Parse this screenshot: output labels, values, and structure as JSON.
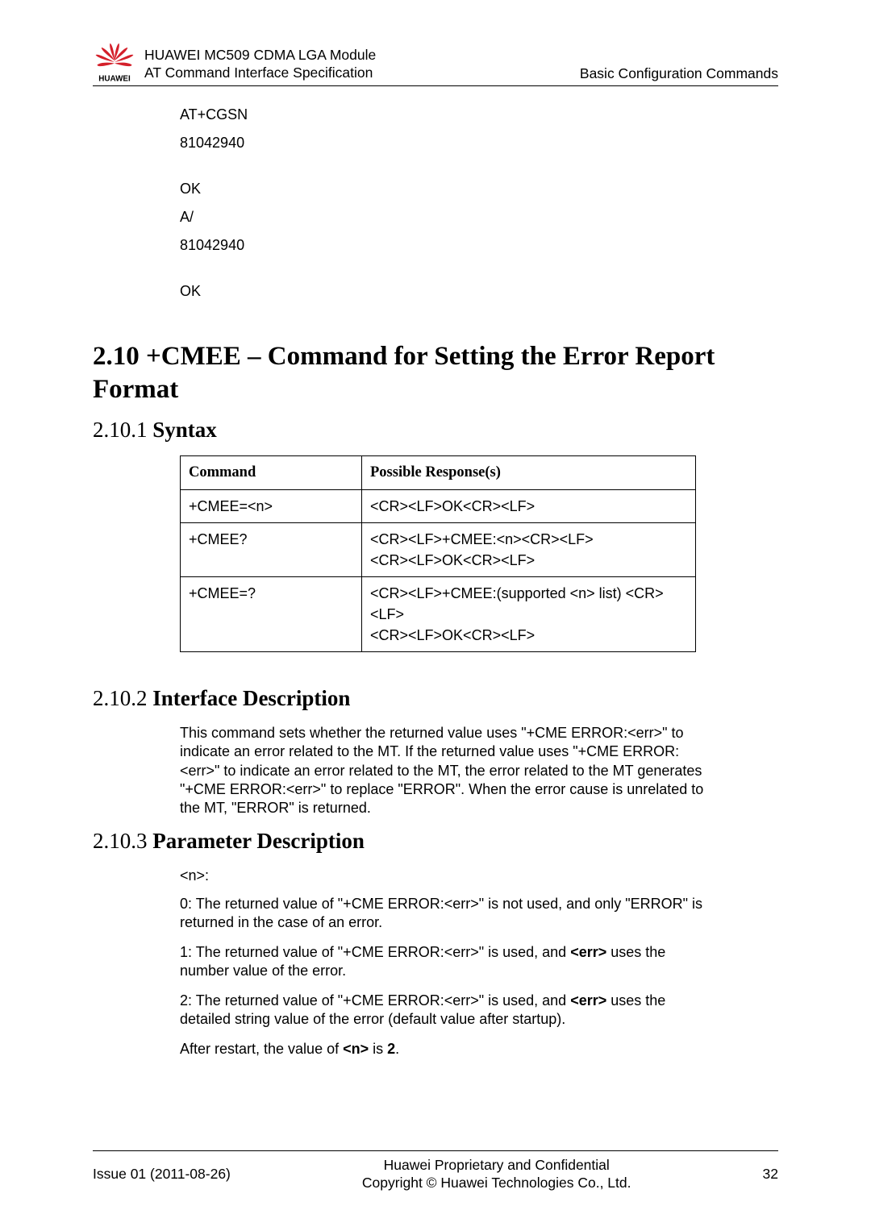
{
  "header": {
    "line1": "HUAWEI MC509 CDMA LGA Module",
    "line2": "AT Command Interface Specification",
    "right": "Basic Configuration Commands",
    "logo_text": "HUAWEI"
  },
  "code": {
    "l1": "AT+CGSN",
    "l2": "81042940",
    "l3": "OK",
    "l4": "A/",
    "l5": "81042940",
    "l6": "OK"
  },
  "section": {
    "h2": "2.10 +CMEE – Command for Setting the Error Report Format",
    "s1_num": "2.10.1 ",
    "s1_title": "Syntax",
    "s2_num": "2.10.2 ",
    "s2_title": "Interface Description",
    "s3_num": "2.10.3 ",
    "s3_title": "Parameter Description"
  },
  "table": {
    "h1": "Command",
    "h2": "Possible Response(s)",
    "r1c1": "+CMEE=<n>",
    "r1c2": "<CR><LF>OK<CR><LF>",
    "r2c1": "+CMEE?",
    "r2c2a": "<CR><LF>+CMEE:<n><CR><LF>",
    "r2c2b": "<CR><LF>OK<CR><LF>",
    "r3c1": "+CMEE=?",
    "r3c2a": "<CR><LF>+CMEE:(supported <n> list) <CR><LF>",
    "r3c2b": "<CR><LF>OK<CR><LF>"
  },
  "desc": {
    "interface": "This command sets whether the returned value uses \"+CME ERROR:<err>\" to indicate an error related to the MT. If the returned value uses \"+CME ERROR:<err>\" to indicate an error related to the MT, the error related to the MT generates \"+CME ERROR:<err>\" to replace \"ERROR\". When the error cause is unrelated to the MT, \"ERROR\" is returned.",
    "param_n": "<n>:",
    "param_0": "0: The returned value of \"+CME ERROR:<err>\" is not used, and only \"ERROR\" is returned in the case of an error.",
    "param_1_pre": "1: The returned value of \"+CME ERROR:<err>\" is used, and ",
    "param_1_bold": "<err>",
    "param_1_post": " uses the number value of the error.",
    "param_2_pre": "2: The returned value of \"+CME ERROR:<err>\" is used, and ",
    "param_2_bold": "<err>",
    "param_2_post": " uses the detailed string value of the error (default value after startup).",
    "param_after_pre": "After restart, the value of ",
    "param_after_b1": "<n>",
    "param_after_mid": " is ",
    "param_after_b2": "2",
    "param_after_post": "."
  },
  "footer": {
    "left": "Issue 01 (2011-08-26)",
    "center1": "Huawei Proprietary and Confidential",
    "center2": "Copyright © Huawei Technologies Co., Ltd.",
    "right": "32"
  }
}
